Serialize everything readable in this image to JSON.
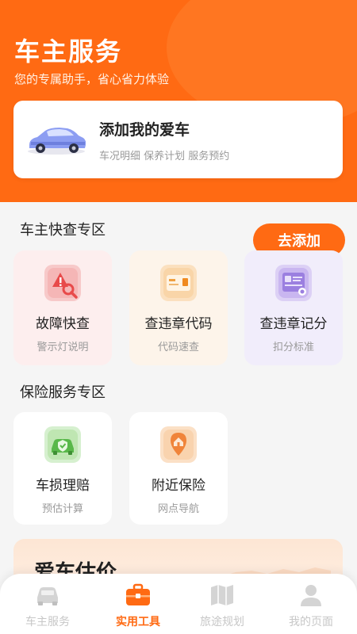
{
  "header": {
    "title": "车主服务",
    "subtitle": "您的专属助手，省心省力体验"
  },
  "car_card": {
    "title": "添加我的爱车",
    "description": "车况明细 保养计划 服务预约",
    "button_label": "去添加"
  },
  "quick_section": {
    "title": "车主快查专区",
    "tiles": [
      {
        "title": "故障快查",
        "subtitle": "警示灯说明",
        "icon": "warning-search-icon",
        "bg": "#fdeeee"
      },
      {
        "title": "查违章代码",
        "subtitle": "代码速查",
        "icon": "code-card-icon",
        "bg": "#fdf4ea"
      },
      {
        "title": "查违章记分",
        "subtitle": "扣分标准",
        "icon": "license-card-icon",
        "bg": "#f1edfb"
      }
    ]
  },
  "insurance_section": {
    "title": "保险服务专区",
    "tiles": [
      {
        "title": "车损理赔",
        "subtitle": "预估计算",
        "icon": "car-shield-icon",
        "bg": "#ffffff"
      },
      {
        "title": "附近保险",
        "subtitle": "网点导航",
        "icon": "location-pin-icon",
        "bg": "#ffffff"
      }
    ]
  },
  "estimate_card": {
    "title": "爱车估价"
  },
  "tabbar": {
    "tabs": [
      {
        "label": "车主服务",
        "icon": "car-icon",
        "active": false
      },
      {
        "label": "实用工具",
        "icon": "toolbox-icon",
        "active": true
      },
      {
        "label": "旅途规划",
        "icon": "map-icon",
        "active": false
      },
      {
        "label": "我的页面",
        "icon": "person-icon",
        "active": false
      }
    ]
  },
  "colors": {
    "accent": "#ff6a13",
    "inactive_tab": "#c7c7c7"
  }
}
